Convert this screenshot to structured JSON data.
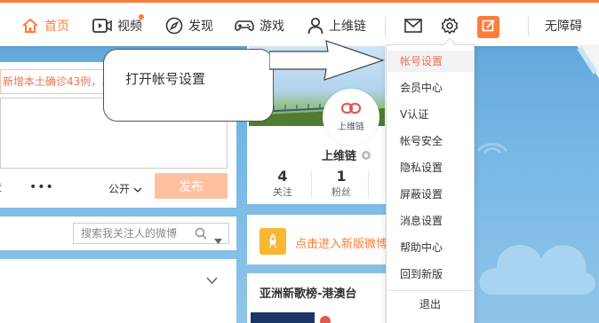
{
  "nav": {
    "home": "首页",
    "video": "视频",
    "discover": "发现",
    "game": "游戏",
    "user": "上维链",
    "accessibility": "无障碍"
  },
  "left": {
    "news_snippet": "新增本土确诊43例，其",
    "more": "•••",
    "public": "公开",
    "publish": "发布",
    "search_placeholder": "搜索我关注人的微博"
  },
  "callout": {
    "text": "打开帐号设置"
  },
  "profile": {
    "avatar_text": "上维链",
    "name": "上维链",
    "stats": [
      {
        "value": "4",
        "label": "关注"
      },
      {
        "value": "1",
        "label": "粉丝"
      }
    ],
    "new_version": "点击进入新版微博",
    "rank_title": "亚洲新歌榜-港澳台"
  },
  "dropdown": {
    "items": [
      "帐号设置",
      "会员中心",
      "V认证",
      "帐号安全",
      "隐私设置",
      "屏蔽设置",
      "消息设置",
      "帮助中心",
      "回到新版"
    ],
    "logout": "退出"
  },
  "colors": {
    "accent": "#fa7d3c",
    "publish_disabled": "#ffc09f"
  }
}
